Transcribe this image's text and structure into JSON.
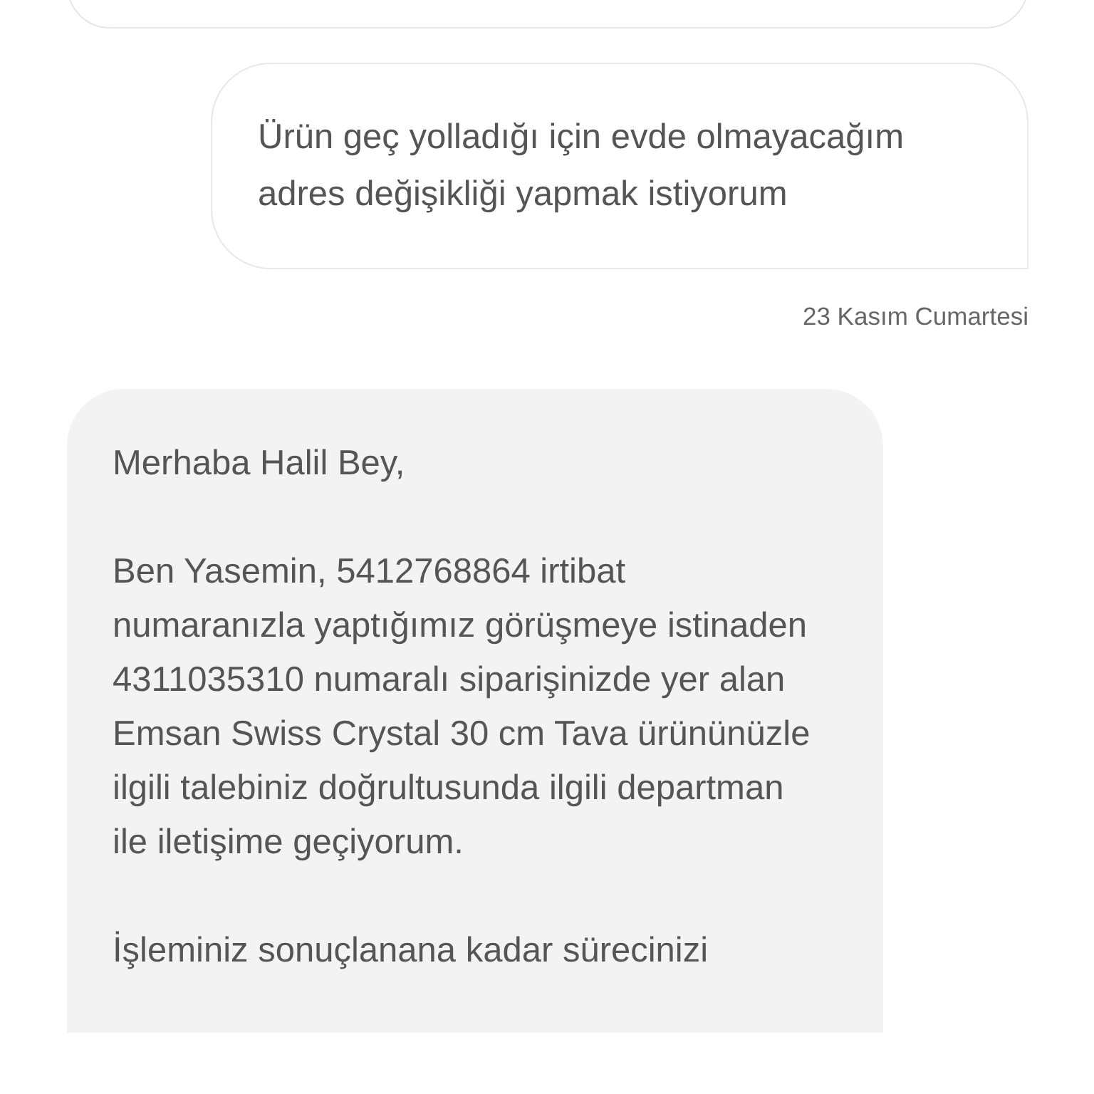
{
  "messages": [
    {
      "kind": "incoming_cut"
    },
    {
      "kind": "outgoing",
      "paragraphs": [
        "Ürün geç yolladığı için evde olmayacağım adres değişikliği yapmak istiyorum"
      ],
      "date": "23 Kasım Cumartesi"
    },
    {
      "kind": "incoming",
      "paragraphs": [
        "Merhaba Halil Bey,",
        "Ben Yasemin, 5412768864 irtibat numaranızla yaptığımız görüşmeye istinaden 4311035310 numaralı siparişinizde yer alan Emsan Swiss Crystal 30 cm Tava ürününüzle ilgili talebiniz doğrultusunda ilgili departman ile iletişime geçiyorum.",
        "İşleminiz sonuçlanana kadar sürecinizi"
      ]
    }
  ]
}
